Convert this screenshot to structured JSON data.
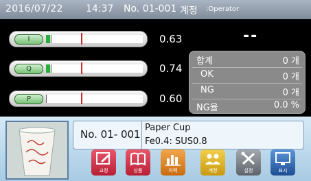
{
  "header": {
    "date": "2016/07/22",
    "time": "14:37",
    "product_no": "No. 01-001",
    "account_label": "계정",
    "user": ":Operator"
  },
  "gauges": [
    {
      "label": "I",
      "value": "0.63",
      "level": 0.05
    },
    {
      "label": "Q",
      "value": "0.74",
      "level": 0.05
    },
    {
      "label": "P",
      "value": "0.60",
      "level": 0.0
    }
  ],
  "status_value": "--",
  "counters": [
    {
      "label": "합계",
      "value": "0 개"
    },
    {
      "label": "OK",
      "value": "0 개"
    },
    {
      "label": "NG",
      "value": "0 개"
    },
    {
      "label": "NG율",
      "value": "0.0 %"
    }
  ],
  "product": {
    "number": "No. 01- 001",
    "name": "Paper Cup",
    "spec": "Fe0.4: SUS0.8"
  },
  "buttons": [
    {
      "label": "교정",
      "icon": "edit-icon",
      "color": "#d4324a"
    },
    {
      "label": "상품",
      "icon": "book-icon",
      "color": "#d4324a"
    },
    {
      "label": "이력",
      "icon": "chart-icon",
      "color": "#e58a1f"
    },
    {
      "label": "계정",
      "icon": "users-icon",
      "color": "#e0b81f"
    },
    {
      "label": "설정",
      "icon": "tools-icon",
      "color": "#7a8088"
    },
    {
      "label": "표시",
      "icon": "display-icon",
      "color": "#2f6fb8"
    }
  ]
}
